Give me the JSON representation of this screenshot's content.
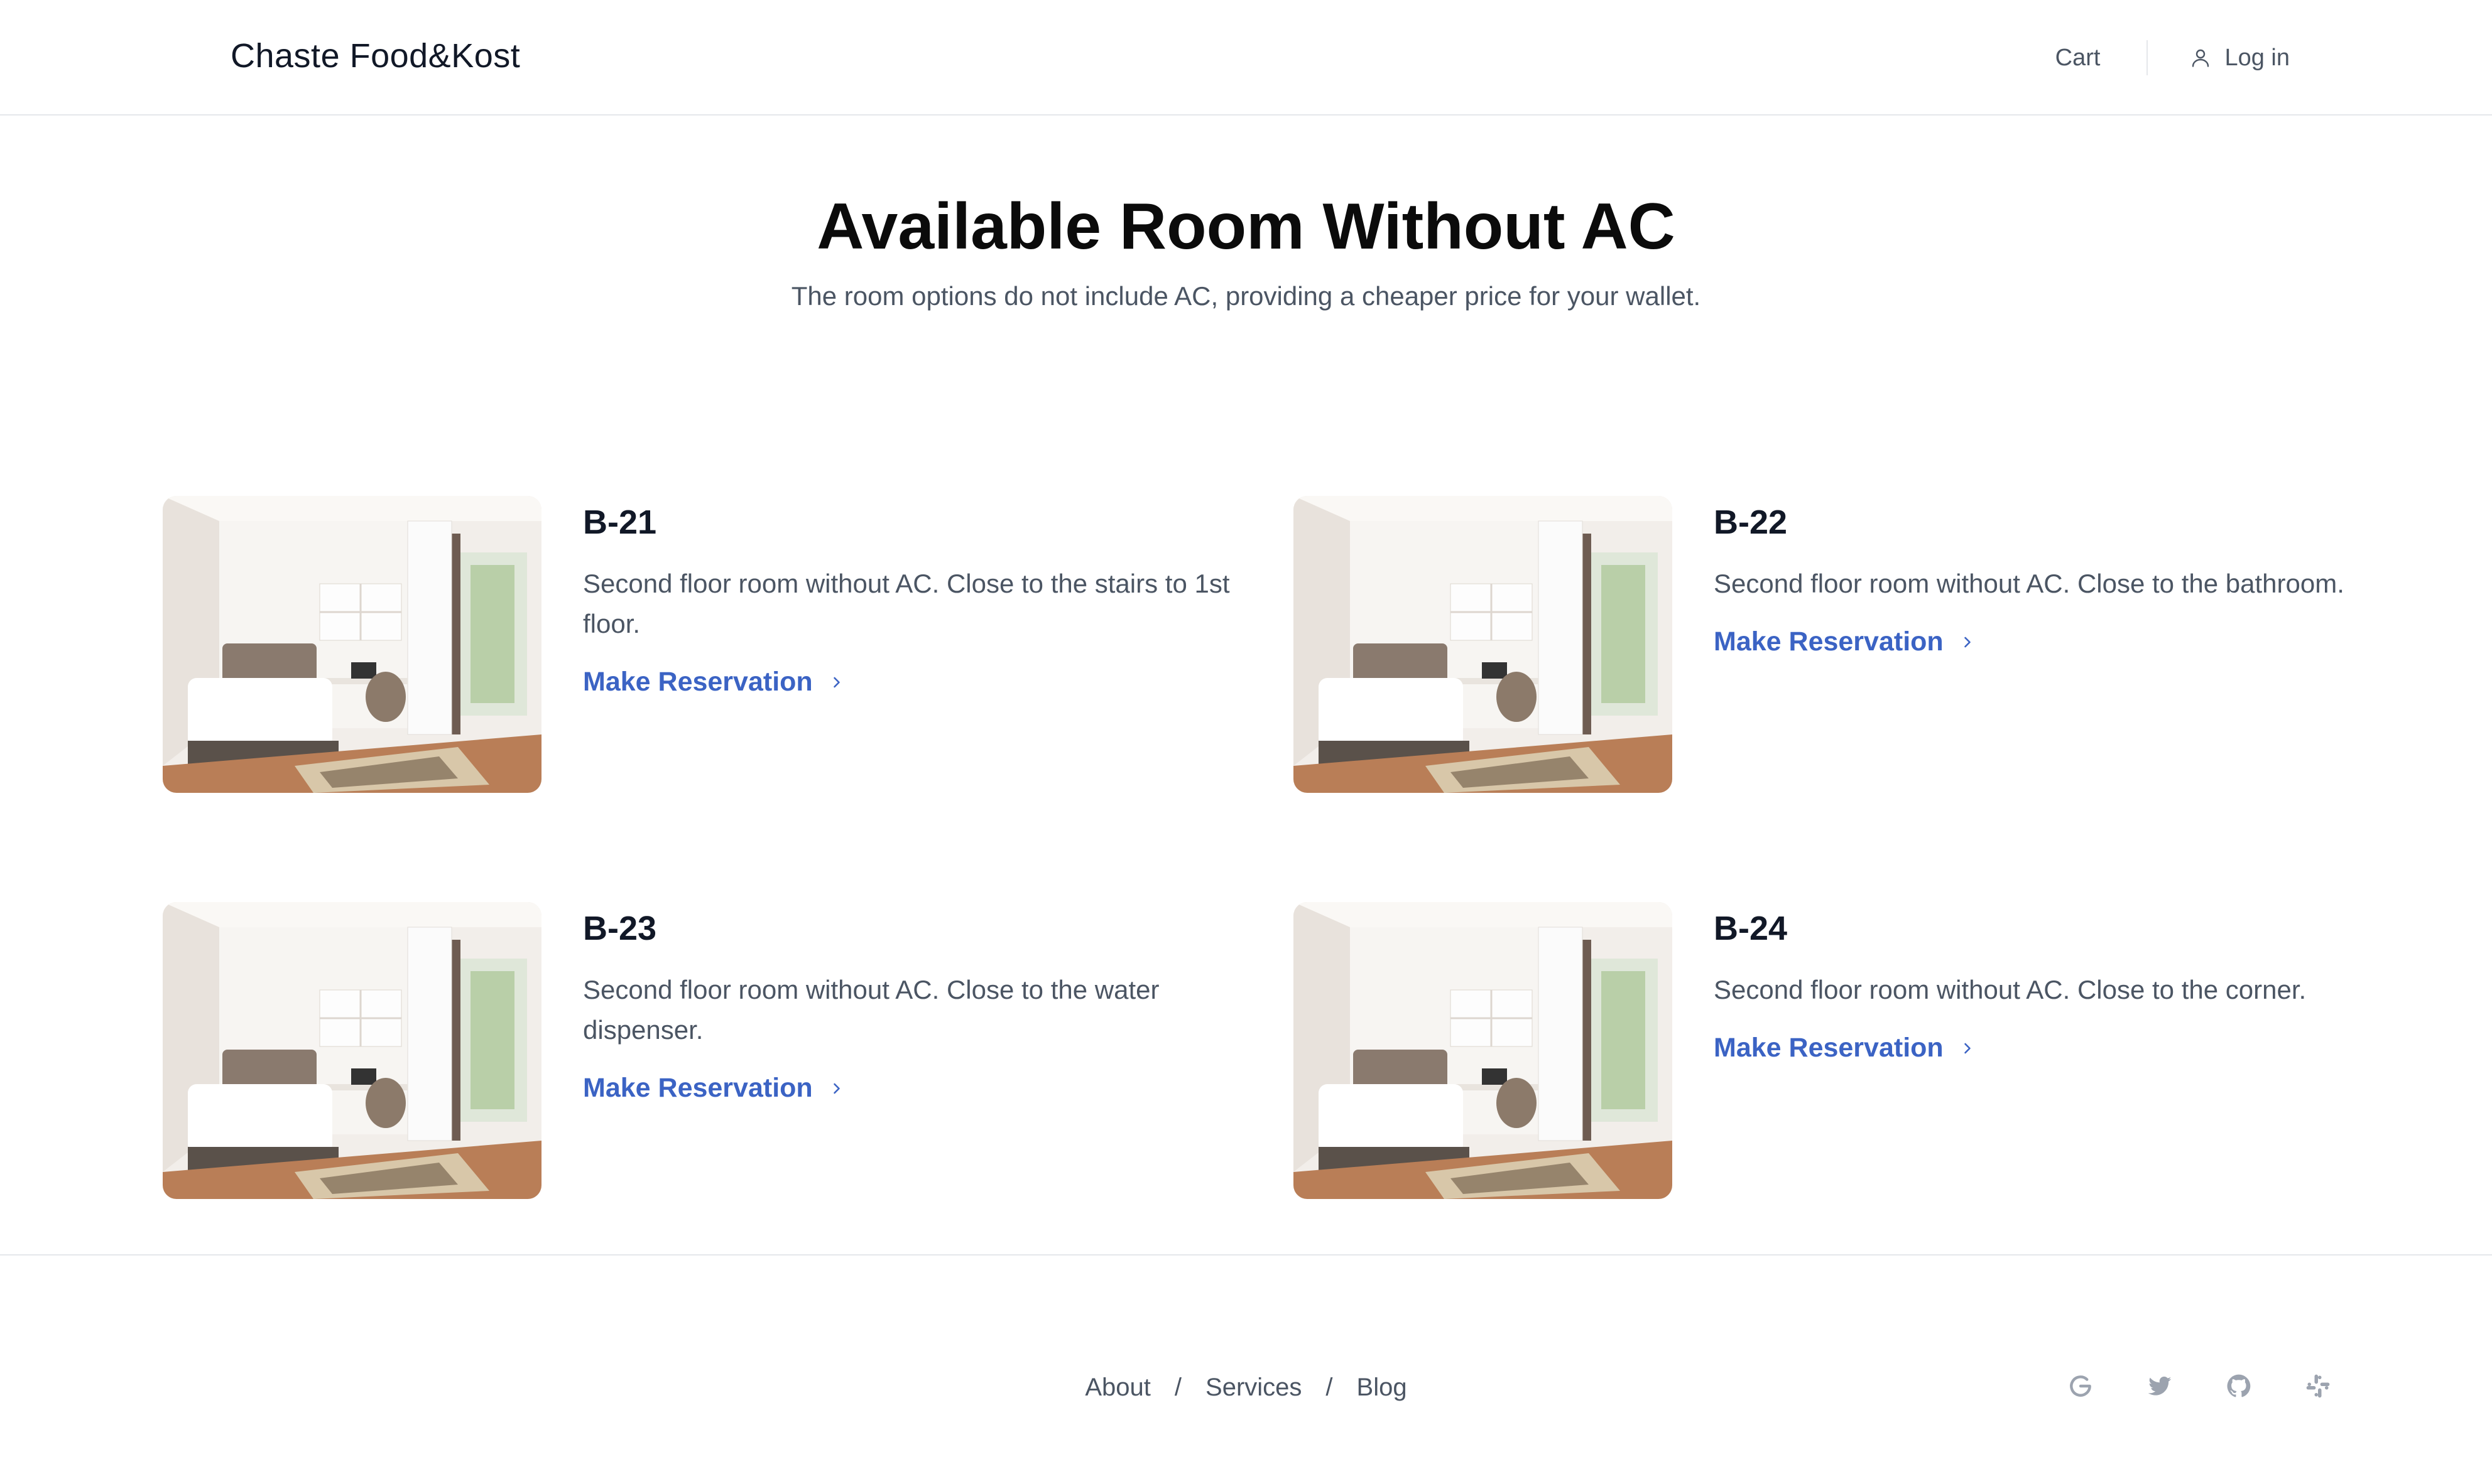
{
  "header": {
    "brand": "Chaste Food&Kost",
    "cart_label": "Cart",
    "login_label": "Log in"
  },
  "hero": {
    "title": "Available Room Without AC",
    "subtitle": "The room options do not include AC, providing a cheaper price for your wallet."
  },
  "rooms": [
    {
      "name": "B-21",
      "description": "Second floor room without AC. Close to the stairs to 1st floor.",
      "cta": "Make Reservation"
    },
    {
      "name": "B-22",
      "description": "Second floor room without AC. Close to the bathroom.",
      "cta": "Make Reservation"
    },
    {
      "name": "B-23",
      "description": "Second floor room without AC. Close to the water dispenser.",
      "cta": "Make Reservation"
    },
    {
      "name": "B-24",
      "description": "Second floor room without AC. Close to the corner.",
      "cta": "Make Reservation"
    }
  ],
  "footer": {
    "links": [
      "About",
      "Services",
      "Blog"
    ],
    "separator": "/",
    "social_icons": [
      "google-icon",
      "twitter-icon",
      "github-icon",
      "slack-icon"
    ]
  },
  "colors": {
    "accent": "#3b63c4",
    "text_muted": "#4b5563",
    "divider": "#e5e7eb"
  }
}
